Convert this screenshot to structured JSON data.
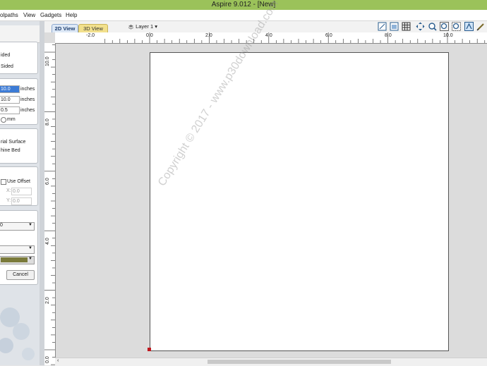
{
  "window": {
    "title": "Aspire 9.012 - [New]"
  },
  "menu": [
    "olpaths",
    "View",
    "Gadgets",
    "Help"
  ],
  "left_panel": {
    "sides": [
      "ided",
      "Sided"
    ],
    "dimensions": [
      {
        "value": "10.0",
        "unit": "inches"
      },
      {
        "value": "10.0",
        "unit": "inches"
      },
      {
        "value": "0.5",
        "unit": "inches"
      }
    ],
    "units_option": "mm",
    "zero_options": [
      "rial Surface",
      "hine Bed"
    ],
    "use_offset_label": "Use Offset",
    "offset": {
      "x_label": "X:",
      "x_value": "0.0",
      "y_label": "Y:",
      "y_value": "0.0"
    },
    "dropdown1_value": "0",
    "cancel_label": "Cancel"
  },
  "toolbar": {
    "tabs": [
      {
        "label": "2D View"
      },
      {
        "label": "3D View"
      }
    ],
    "layer_label": "Layer 1",
    "icons": [
      "view-2d-icon",
      "view-3d-icon",
      "grid-icon",
      "pan-icon",
      "zoom-icon",
      "zoom-fit-icon",
      "zoom-selection-icon",
      "snap-icon",
      "vector-tool-icon"
    ]
  },
  "ruler": {
    "h_labels": [
      "-2.0",
      "0.0",
      "2.0",
      "4.0",
      "6.0",
      "8.0",
      "10.0"
    ],
    "v_labels": [
      "10.0",
      "8.0",
      "6.0",
      "4.0",
      "2.0",
      "0.0"
    ]
  },
  "watermark": "Copyright © 2017 - www.p30download.com",
  "colors": {
    "titlebar": "#9bc25a",
    "origin_marker": "#c0181e",
    "material_swatch": "#7a7a3a"
  }
}
